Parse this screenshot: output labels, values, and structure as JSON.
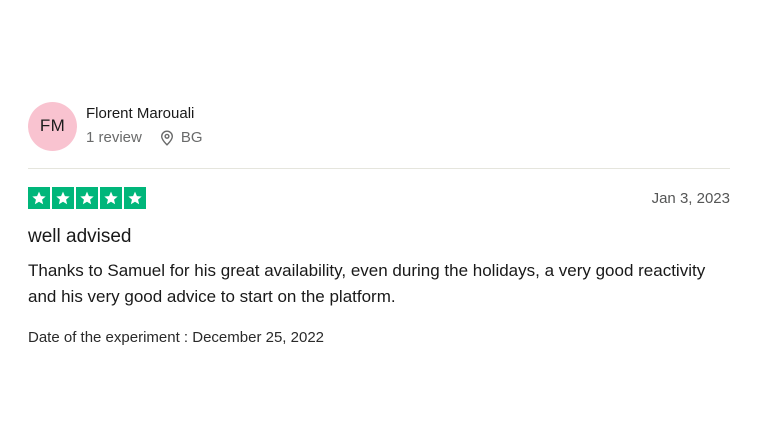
{
  "consumer": {
    "initials": "FM",
    "name": "Florent Marouali",
    "review_count": "1 review",
    "country": "BG",
    "avatar_color": "#f9c3d0"
  },
  "review": {
    "rating": 5,
    "rating_max": 5,
    "star_color": "#00b67a",
    "date": "Jan 3, 2023",
    "title": "well advised",
    "text": "Thanks to Samuel for his great availability, even during the holidays, a very good reactivity and his very good advice to start on the platform.",
    "experience_date": "Date of the experiment : December 25, 2022"
  },
  "icons": {
    "location": "location-pin-icon",
    "star": "star-icon"
  }
}
